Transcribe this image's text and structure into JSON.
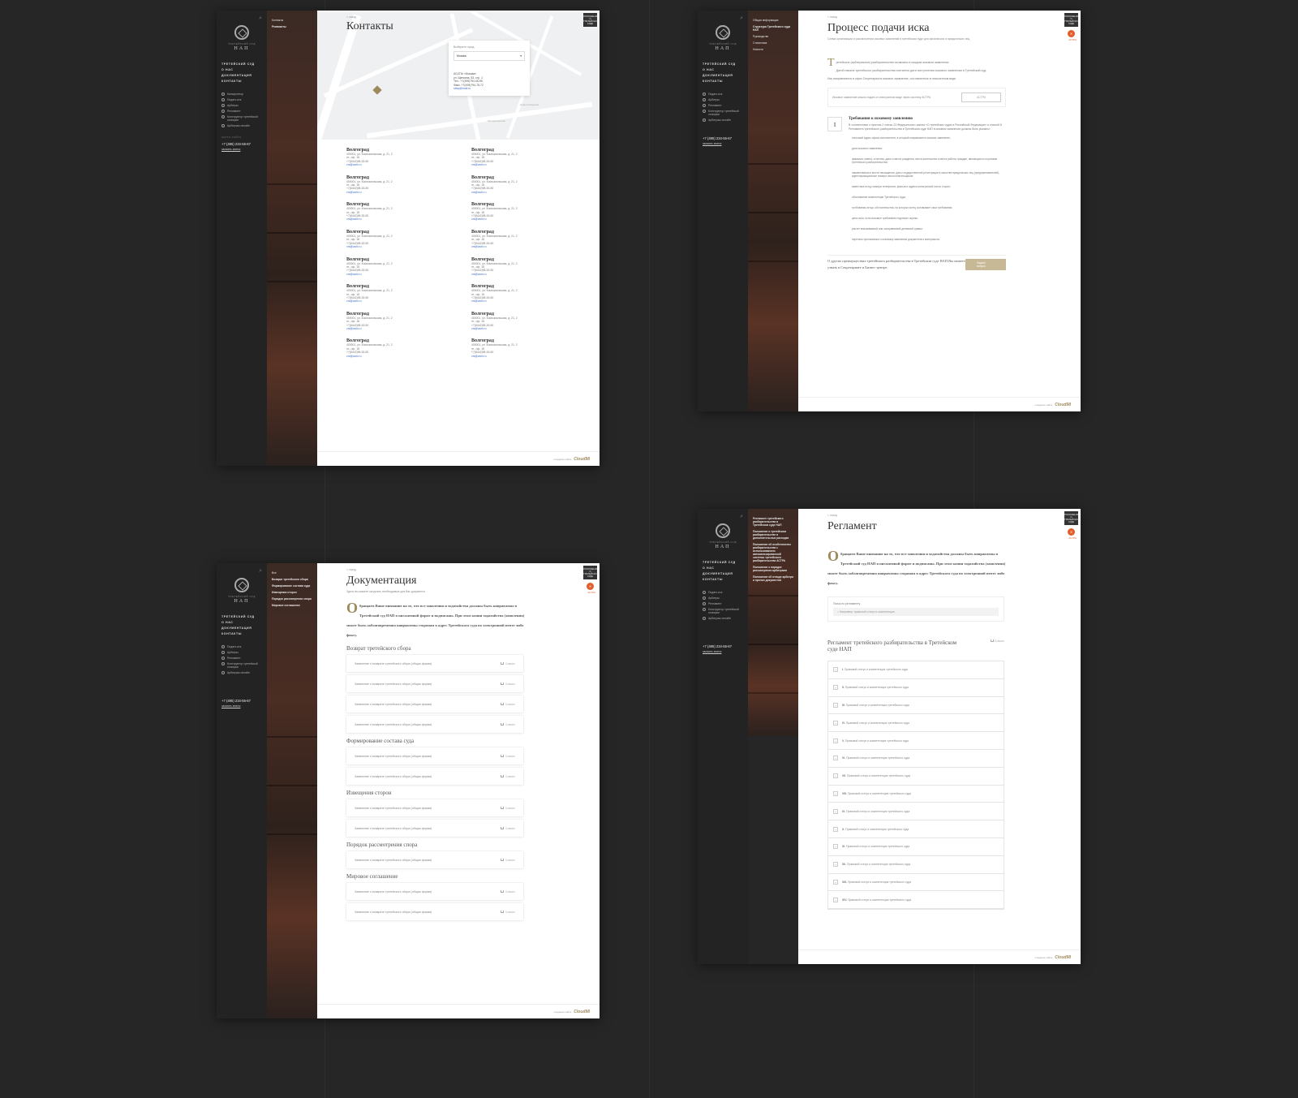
{
  "brand": {
    "sub": "ТРЕТЕЙСКИЙ СУД",
    "name": "НАП"
  },
  "nav": {
    "main": [
      "ТРЕТЕЙСКИЙ СУД",
      "О НАС",
      "ДОКУМЕНТАЦИЯ",
      "КОНТАКТЫ"
    ],
    "side_full": [
      "Калькулятор",
      "Подать иск",
      "Арбитры",
      "Регламент",
      "Конструктор третейской оговорки",
      "Арбитраж онлайн"
    ],
    "side_short": [
      "Подать иск",
      "Арбитры",
      "Регламент",
      "Конструктор третейской оговорки",
      "Арбитраж онлайн"
    ],
    "call_caption": "КАРТА САЙТА",
    "phone": "+7 (495) 234-55-67",
    "callback": "заказать звонок"
  },
  "top": {
    "tag_label": "ПОЛОЖЕНИЕ О ТРЕТЕЙСКОМ СУДЕ",
    "badge": "✕",
    "badge_label": "АСТРА"
  },
  "footer": {
    "label": "создание сайта",
    "brand": "Cloud98"
  },
  "contacts": {
    "crumb": "< назад",
    "subnav": [
      "Контакты",
      "Реквизиты"
    ],
    "title": "Контакты",
    "map": {
      "caption": "Выберите город",
      "city": "Москва",
      "lines": [
        "АСОПА «Москва»",
        "ул. Щепкина, 53, стр. 1",
        "Тел.: +7(495)794-06-55,",
        "Факс: +7(495)794-78-72",
        "ratsp@mail.ru"
      ],
      "labels": [
        "Новослободская",
        "Менделеевская"
      ]
    },
    "card": {
      "city": "Волгоград",
      "address": "400001, ул. Комсомольская, д. 21, 2",
      "office": "эт., оф. 18",
      "phone": "+7(8442)98-53-50",
      "email": "vrs@arzb.ru"
    }
  },
  "process": {
    "crumb": "< назад",
    "subnav": [
      "Общая информация",
      "Структура Третейского суда НАП",
      "Руководство",
      "Статистика",
      "Новости"
    ],
    "title": "Процесс подачи иска",
    "lead": "Схема организации и рассмотрения исковых заявлений в третейском суде для физических и юридических лиц",
    "drop": "Т",
    "paras": [
      "ретейское (арбитражное) разбирательство возможно в каждом исковом заявлении.",
      "Датой начала третейского разбирательства считается дата поступления искового заявления в Третейский суд.",
      "Иск направляется в офис Секретариата исковое заявление, составленное в письменном виде."
    ],
    "note": "Исковое заявление можно подать в электронном виде через систему АСТРА",
    "note_btn": "АСТРА",
    "req_num": "I",
    "req_title": "Требования к исковому заявлению",
    "req_desc": "В соответствии с пунктом 2 статьи 23 Федерального закона «О третейских судах в Российской Федерации» и статьей 8 Регламента третейского разбирательства в Третейском суде НАП в исковом заявлении должны быть указаны:",
    "reqs": [
      "почтовый адрес офиса исполнителя, в который направляется исковое заявление;",
      "дата искового заявления;",
      "фамилии, имена, отчества, даты и места рождения, места жительства и места работы граждан, являющихся сторонами третейского разбирательства;",
      "наименования и места нахождения, даты государственной регистрации в качестве юридических лиц (предпринимателей), идентификационные номера налогоплательщиков;",
      "известные истцу номера телефонов, факсов и адреса электронной почты сторон;",
      "обоснование компетенции Третейского суда;",
      "требования истца, обстоятельства, на которых истец основывает свои требования;",
      "цена иска, если исковые требования подлежат оценке;",
      "расчет взыскиваемой или оспариваемой денежной суммы;",
      "перечень прилагаемых к исковому заявлению документов и материалов."
    ],
    "cta": "О других преимуществах третейского разбирательства в Третейском суде НАП Вы можете узнать в Секретариате и Бизнес-центре.",
    "cta_btn": "Задать вопрос"
  },
  "docs": {
    "crumb": "< назад",
    "subnav": [
      "Все",
      "Возврат третейского сбора",
      "Формирование состава суда",
      "Извещения сторон",
      "Порядок рассмотрения спора",
      "Мировое соглашение"
    ],
    "title": "Документация",
    "lead": "Здесь вы можете загрузить необходимые для Вас документы",
    "drop": "О",
    "intro": "бращаем Ваше внимание на то, что все заявления и ходатайства должны быть направлены в Третейский суд НАП в письменной форме и подписаны. При этом копии ходатайства (заявления) может быть заблаговременно направлены сторонам в адрес Третейского суда по электронной почте либо факсу.",
    "doc_name": "Заявление о возврате третейского сбора (общая форма)",
    "download": "Скачать",
    "sections": [
      "Возврат третейского сбора",
      "Формирование состава суда",
      "Извещения сторон",
      "Порядок рассмотрения спора",
      "Мировое соглашение"
    ]
  },
  "reglament": {
    "crumb": "< назад",
    "subnav": [
      "Регламент третейского разбирательства в Третейском суде НАП",
      "Положение о третейском разбирательстве и дополнительных расходах",
      "Положение об особенностях разбирательства с использованием автоматизированной системы третейского разбирательства АСТРА",
      "Положение о порядке рассмотрения арбитрами",
      "Положение об отводе арбитра и прочих документов"
    ],
    "title": "Регламент",
    "drop": "О",
    "intro": "бращаем Ваше внимание на то, что все заявления и ходатайства должны быть направлены в Третейский суд НАП в письменной форме и подписаны. При этом копии ходатайства (заявления) может быть заблаговременно направлены сторонам в адрес Третейского суда по электронной почте либо факсу.",
    "search_caption": "Поиск по регламенту",
    "search_placeholder": "Например: правовой статус и компетенция",
    "heading": "Регламент третейского разбирательства в Третейском суде НАП",
    "download": "Скачать",
    "row_text": "Правовой статус и компетенция третейского суда",
    "numerals": [
      "I.",
      "II.",
      "III.",
      "IV.",
      "V.",
      "VI.",
      "VII.",
      "VIII.",
      "IX.",
      "X.",
      "XI.",
      "XII.",
      "XIII.",
      "XIV."
    ]
  }
}
